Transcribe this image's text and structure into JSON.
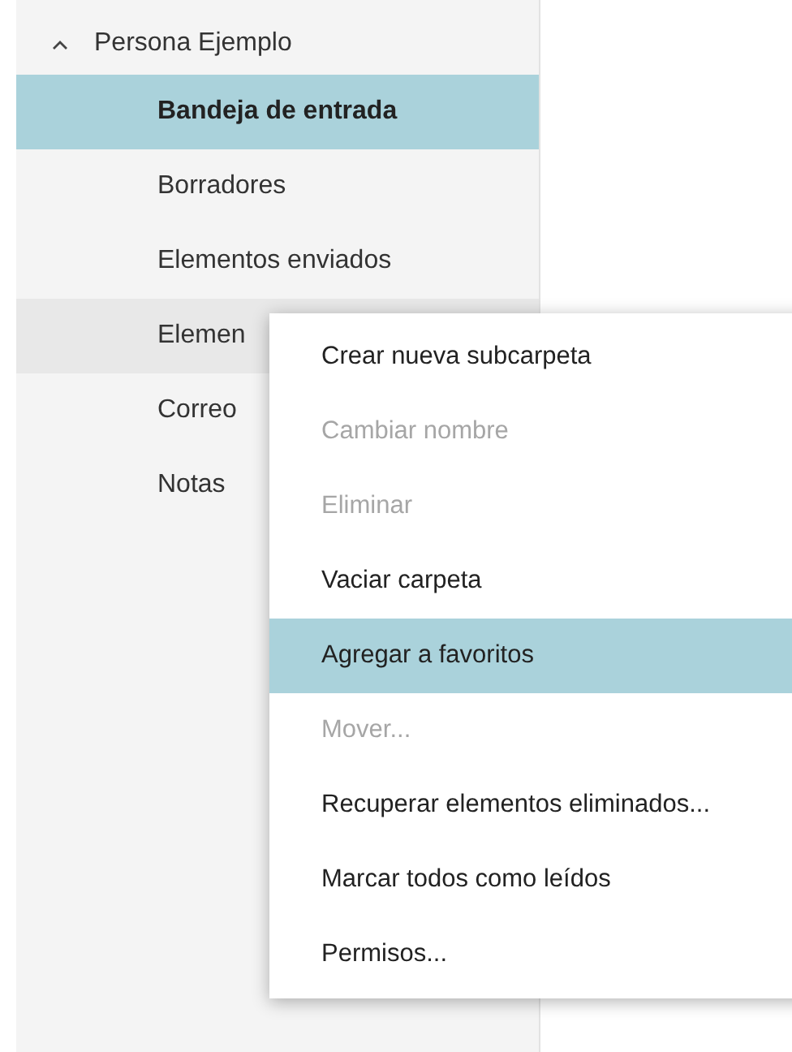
{
  "account": {
    "name": "Persona Ejemplo",
    "expanded": true
  },
  "folders": [
    {
      "label": "Bandeja de entrada",
      "selected": true,
      "hovered": false
    },
    {
      "label": "Borradores",
      "selected": false,
      "hovered": false
    },
    {
      "label": "Elementos enviados",
      "selected": false,
      "hovered": false
    },
    {
      "label": "Elemen",
      "selected": false,
      "hovered": true
    },
    {
      "label": "Correo",
      "selected": false,
      "hovered": false
    },
    {
      "label": "Notas",
      "selected": false,
      "hovered": false
    }
  ],
  "context_menu": [
    {
      "label": "Crear nueva subcarpeta",
      "disabled": false,
      "selected": false
    },
    {
      "label": "Cambiar nombre",
      "disabled": true,
      "selected": false
    },
    {
      "label": "Eliminar",
      "disabled": true,
      "selected": false
    },
    {
      "label": "Vaciar carpeta",
      "disabled": false,
      "selected": false
    },
    {
      "label": "Agregar a favoritos",
      "disabled": false,
      "selected": true
    },
    {
      "label": "Mover...",
      "disabled": true,
      "selected": false
    },
    {
      "label": "Recuperar elementos eliminados...",
      "disabled": false,
      "selected": false
    },
    {
      "label": "Marcar todos como leídos",
      "disabled": false,
      "selected": false
    },
    {
      "label": "Permisos...",
      "disabled": false,
      "selected": false
    }
  ]
}
